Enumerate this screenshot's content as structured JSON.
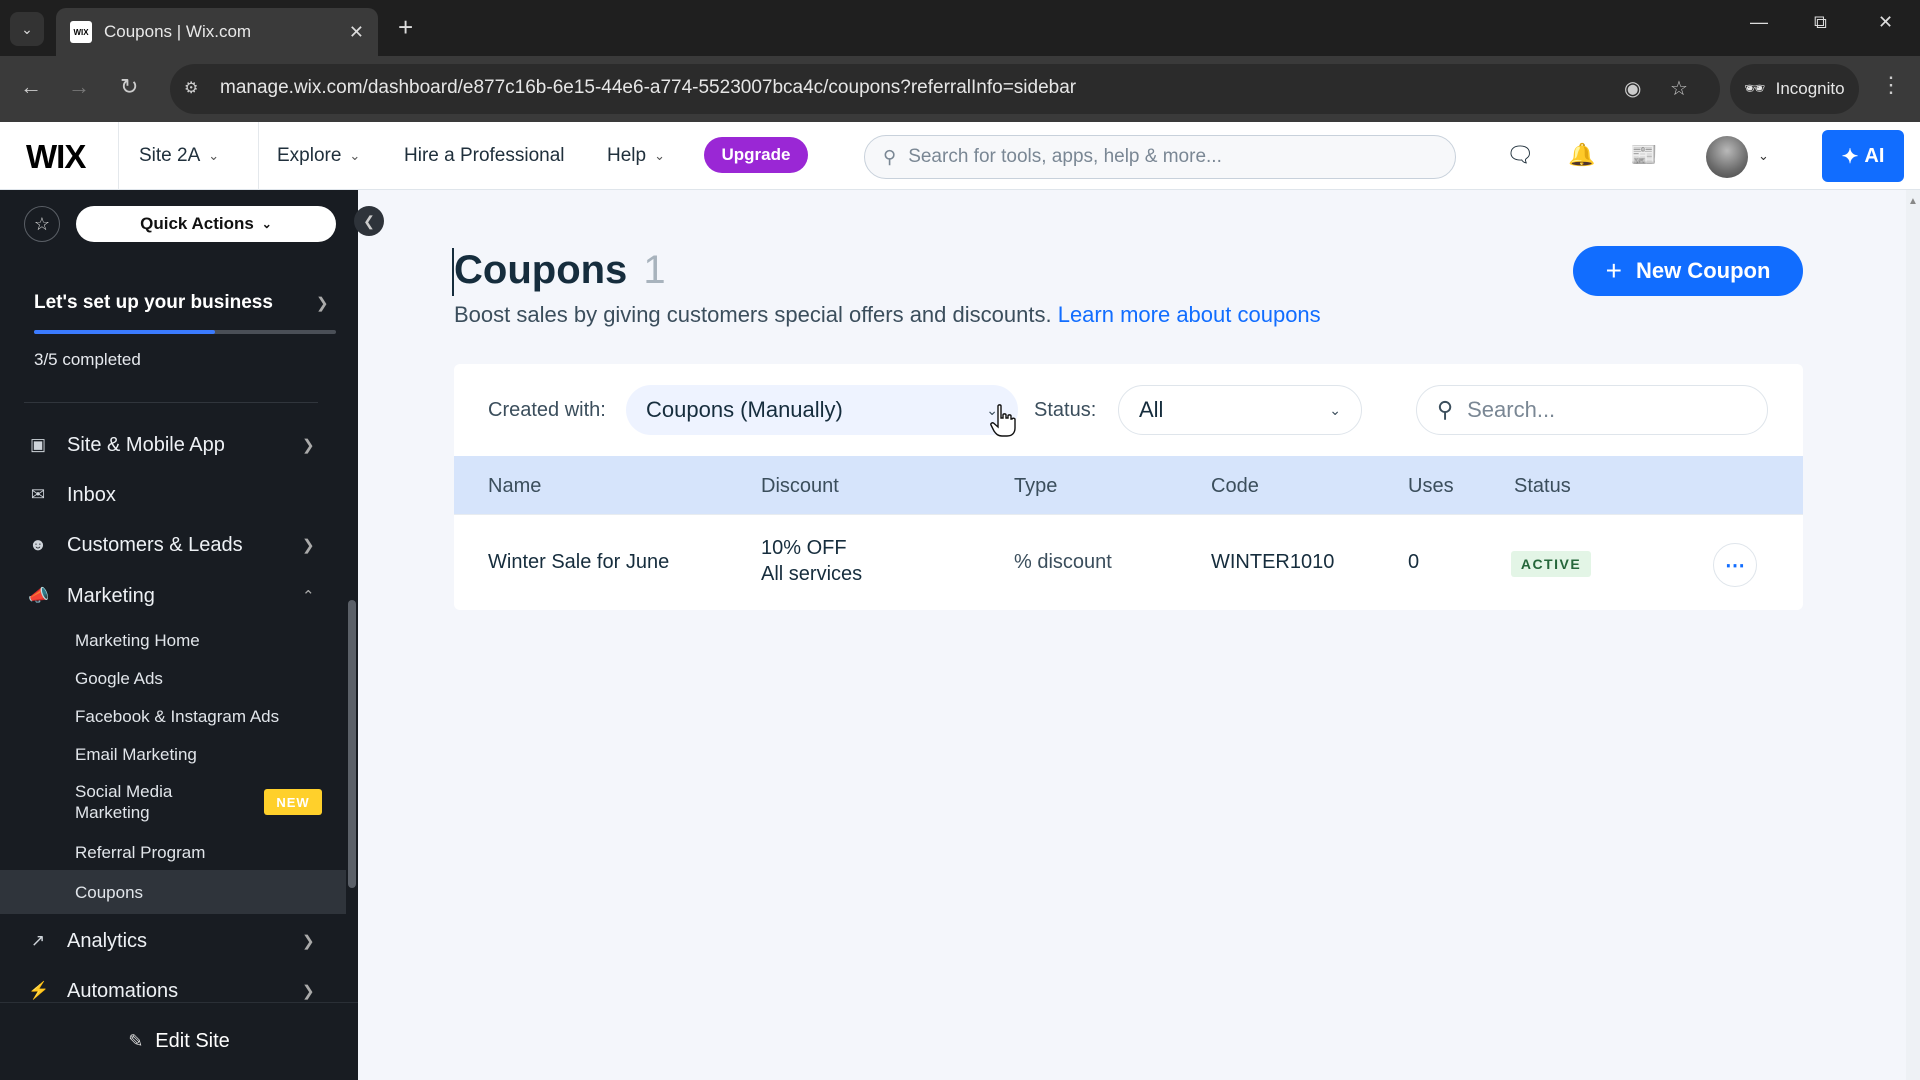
{
  "browser": {
    "tab_title": "Coupons | Wix.com",
    "favicon_text": "WIX",
    "url": "manage.wix.com/dashboard/e877c16b-6e15-44e6-a774-5523007bca4c/coupons?referralInfo=sidebar",
    "incognito_label": "Incognito"
  },
  "topbar": {
    "logo": "WIX",
    "site_name": "Site 2A",
    "explore": "Explore",
    "hire": "Hire a Professional",
    "help": "Help",
    "upgrade": "Upgrade",
    "search_placeholder": "Search for tools, apps, help & more...",
    "ai_label": "AI"
  },
  "sidebar": {
    "quick_actions": "Quick Actions",
    "setup_title": "Let's set up your business",
    "setup_status": "3/5 completed",
    "setup_progress": 0.6,
    "items": [
      {
        "label": "Site & Mobile App",
        "icon": "site-icon"
      },
      {
        "label": "Inbox",
        "icon": "inbox-icon"
      },
      {
        "label": "Customers & Leads",
        "icon": "customers-icon"
      },
      {
        "label": "Marketing",
        "icon": "megaphone-icon"
      }
    ],
    "marketing_sub": [
      {
        "label": "Marketing Home"
      },
      {
        "label": "Google Ads"
      },
      {
        "label": "Facebook & Instagram Ads"
      },
      {
        "label": "Email Marketing"
      },
      {
        "label": "Social Media Marketing",
        "badge": "NEW"
      },
      {
        "label": "Referral Program"
      },
      {
        "label": "Coupons"
      }
    ],
    "bottom_items": [
      {
        "label": "Analytics",
        "icon": "analytics-icon"
      },
      {
        "label": "Automations",
        "icon": "automations-icon"
      }
    ],
    "edit_site": "Edit Site"
  },
  "main": {
    "title": "Coupons",
    "count": "1",
    "subtitle": "Boost sales by giving customers special offers and discounts.",
    "learn_link": "Learn more about coupons",
    "new_coupon": "New Coupon",
    "filters": {
      "created_label": "Created with:",
      "created_value": "Coupons (Manually)",
      "status_label": "Status:",
      "status_value": "All",
      "search_placeholder": "Search..."
    },
    "columns": [
      "Name",
      "Discount",
      "Type",
      "Code",
      "Uses",
      "Status"
    ],
    "rows": [
      {
        "name": "Winter Sale for June",
        "discount_line1": "10% OFF",
        "discount_line2": "All services",
        "type": "% discount",
        "code": "WINTER1010",
        "uses": "0",
        "status": "ACTIVE"
      }
    ]
  },
  "colors": {
    "accent": "#116dff",
    "upgrade": "#9a27d5",
    "sidebar_bg": "#181c22",
    "active_badge_bg": "#e3f5e6",
    "new_badge": "#ffd02b"
  }
}
